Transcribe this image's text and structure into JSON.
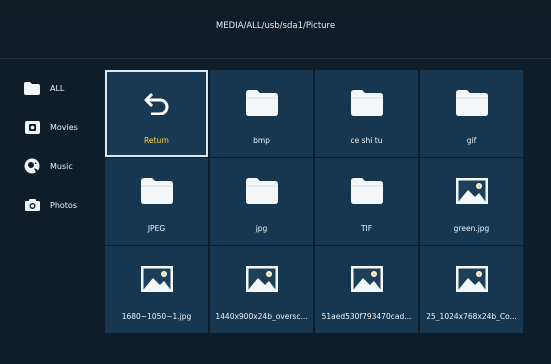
{
  "header": {
    "path": "MEDIA/ALL/usb/sda1/Picture"
  },
  "sidebar": {
    "items": [
      {
        "label": "ALL",
        "icon": "folder-icon"
      },
      {
        "label": "Movies",
        "icon": "movie-icon"
      },
      {
        "label": "Music",
        "icon": "music-icon"
      },
      {
        "label": "Photos",
        "icon": "camera-icon"
      }
    ]
  },
  "grid": {
    "items": [
      {
        "label": "Return",
        "type": "return",
        "selected": true
      },
      {
        "label": "bmp",
        "type": "folder"
      },
      {
        "label": "ce shi tu",
        "type": "folder"
      },
      {
        "label": "gif",
        "type": "folder"
      },
      {
        "label": "JPEG",
        "type": "folder"
      },
      {
        "label": "jpg",
        "type": "folder"
      },
      {
        "label": "TIF",
        "type": "folder"
      },
      {
        "label": "green.jpg",
        "type": "image"
      },
      {
        "label": "1680~1050~1.jpg",
        "type": "image"
      },
      {
        "label": "1440x900x24b_oversc...",
        "type": "image"
      },
      {
        "label": "51aed530f793470cad...",
        "type": "image"
      },
      {
        "label": "25_1024x768x24b_Co...",
        "type": "image"
      }
    ]
  },
  "colors": {
    "background": "#0d1d2a",
    "tile": "#17364f",
    "selected_text": "#ffd43b",
    "text": "#eef3f7"
  }
}
